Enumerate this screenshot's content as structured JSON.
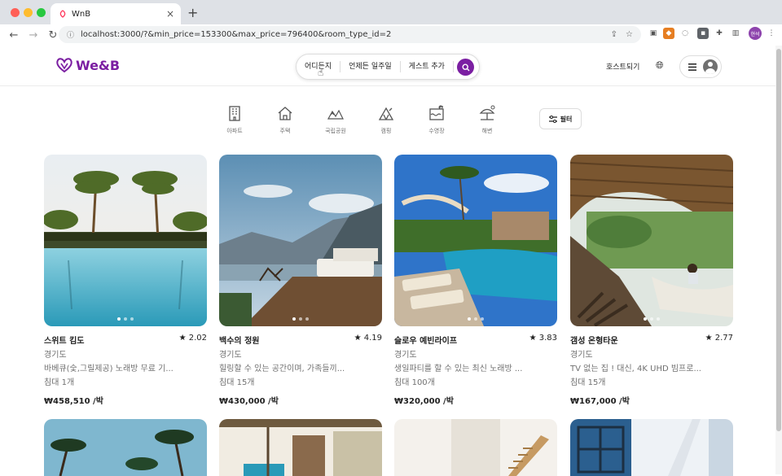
{
  "browser": {
    "tab_title": "WnB",
    "new_tab": "+",
    "url": "localhost:3000/?&min_price=153300&max_price=796400&room_type_id=2",
    "profile_label": "현석"
  },
  "header": {
    "logo_text": "We&B",
    "search": {
      "where": "어디든지",
      "when": "언제든 일주일",
      "guests": "게스트 추가"
    },
    "host_label": "호스트되기"
  },
  "categories": [
    {
      "label": "아파트",
      "icon": "apartment-icon"
    },
    {
      "label": "주택",
      "icon": "house-icon"
    },
    {
      "label": "국립공원",
      "icon": "park-icon"
    },
    {
      "label": "캠핑",
      "icon": "camping-icon"
    },
    {
      "label": "수영장",
      "icon": "pool-icon"
    },
    {
      "label": "해변",
      "icon": "beach-icon"
    }
  ],
  "filter_label": "필터",
  "listings": [
    {
      "title": "스위트 킴도",
      "rating": "2.02",
      "region": "경기도",
      "desc": "바베큐(숯,그릴제공) 노래방 무료 기...",
      "capacity": "침대 1개",
      "price": "₩458,510 /박"
    },
    {
      "title": "백수의 정원",
      "rating": "4.19",
      "region": "경기도",
      "desc": "힐링할 수 있는 공간이며, 가족들끼...",
      "capacity": "침대 15개",
      "price": "₩430,000 /박"
    },
    {
      "title": "슬로우 예빈라이프",
      "rating": "3.83",
      "region": "경기도",
      "desc": "생일파티를 할 수 있는 최신 노래방 ...",
      "capacity": "침대 100개",
      "price": "₩320,000 /박"
    },
    {
      "title": "갬성 온형타운",
      "rating": "2.77",
      "region": "경기도",
      "desc": "TV 없는 집 ! 대신, 4K UHD 빔프로...",
      "capacity": "침대 15개",
      "price": "₩167,000 /박"
    }
  ],
  "colors": {
    "brand": "#7b1fa2"
  }
}
